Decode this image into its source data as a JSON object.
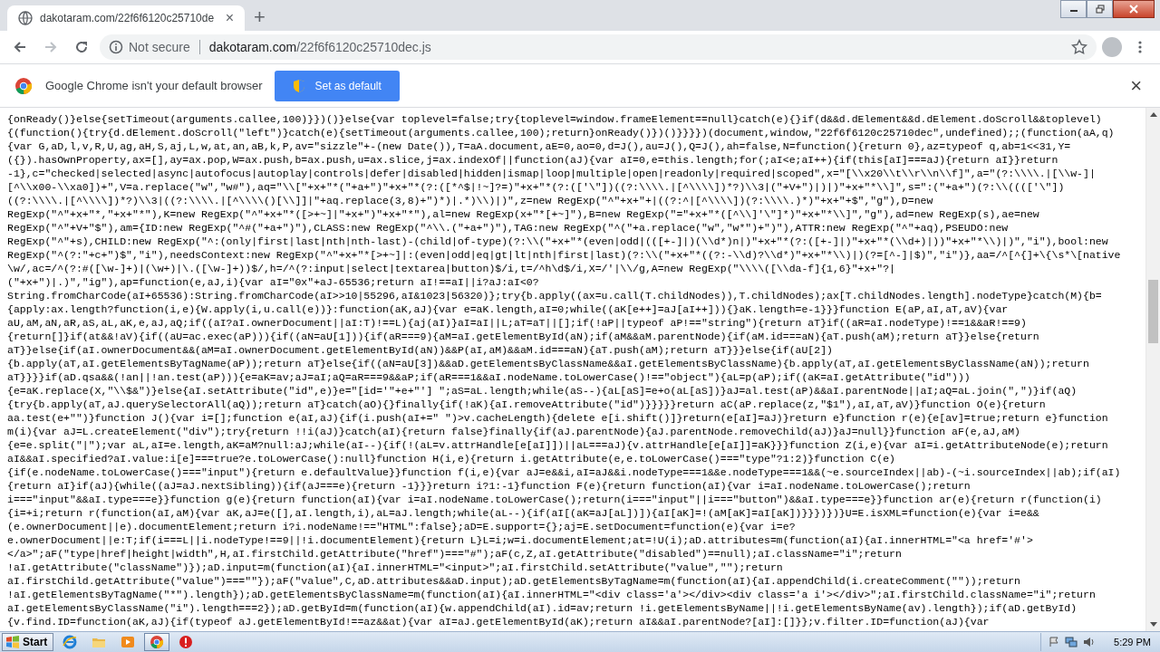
{
  "window": {
    "tab": {
      "title": "dakotaram.com/22f6f6120c25710de",
      "close": "×"
    },
    "new_tab": "+"
  },
  "toolbar": {
    "security": "Not secure",
    "url_host": "dakotaram.com",
    "url_path": "/22f6f6120c25710dec.js"
  },
  "infobar": {
    "message": "Google Chrome isn't your default browser",
    "button": "Set as default",
    "close": "×"
  },
  "code_lines": [
    "{onReady()}else{setTimeout(arguments.callee,100)}})()}else{var toplevel=false;try{toplevel=window.frameElement==null}catch(e){}if(d&&d.dElement&&d.dElement.doScroll&&toplevel)",
    "{(function(){try{d.dElement.doScroll(\"left\")}catch(e){setTimeout(arguments.callee,100);return}onReady()})()}}}})(document,window,\"22f6f6120c25710dec\",undefined);;(function(aA,q)",
    "{var G,aD,l,v,R,U,ag,aH,S,aj,L,w,at,an,aB,k,P,av=\"sizzle\"+-(new Date()),T=aA.document,aE=0,ao=0,d=J(),au=J(),Q=J(),ah=false,N=function(){return 0},az=typeof q,ab=1<<31,Y=",
    "({}).hasOwnProperty,ax=[],ay=ax.pop,W=ax.push,b=ax.push,u=ax.slice,j=ax.indexOf||function(aJ){var aI=0,e=this.length;for(;aI<e;aI++){if(this[aI]===aJ){return aI}}return",
    "-1},c=\"checked|selected|async|autofocus|autoplay|controls|defer|disabled|hidden|ismap|loop|multiple|open|readonly|required|scoped\",x=\"[\\\\x20\\\\t\\\\r\\\\n\\\\f]\",a=\"(?:\\\\\\\\.|[\\\\w-]|",
    "[^\\\\x00-\\\\xa0])+\",V=a.replace(\"w\",\"w#\"),aq=\"\\\\[\"+x+\"*(\"+a+\")\"+x+\"*(?:([*^$|!~]?=)\"+x+\"*(?:(['\\\"])((?:\\\\\\\\.|[^\\\\\\\\])*?)\\\\3|(\"+V+\")|)|)\"+x+\"*\\\\]\",s=\":(\"+a+\")(?:\\\\(((['\\\"])",
    "((?:\\\\\\\\.|[^\\\\\\\\])*?)\\\\3|((?:\\\\\\\\.|[^\\\\\\\\()[\\\\]]|\"+aq.replace(3,8)+\")*)|.*)\\\\)|)\",z=new RegExp(\"^\"+x+\"+|((?:^|[^\\\\\\\\])(?:\\\\\\\\.)*)\"+x+\"+$\",\"g\"),D=new",
    "RegExp(\"^\"+x+\"*,\"+x+\"*\"),K=new RegExp(\"^\"+x+\"*([>+~]|\"+x+\")\"+x+\"*\"),al=new RegExp(x+\"*[+~]\"),B=new RegExp(\"=\"+x+\"*([^\\\\]'\\\"]*)\"+x+\"*\\\\]\",\"g\"),ad=new RegExp(s),ae=new",
    "RegExp(\"^\"+V+\"$\"),am={ID:new RegExp(\"^#(\"+a+\")\"),CLASS:new RegExp(\"^\\\\.(\"+a+\")\"),TAG:new RegExp(\"^(\"+a.replace(\"w\",\"w*\")+\")\"),ATTR:new RegExp(\"^\"+aq),PSEUDO:new",
    "RegExp(\"^\"+s),CHILD:new RegExp(\"^:(only|first|last|nth|nth-last)-(child|of-type)(?:\\\\(\"+x+\"*(even|odd|(([+-]|)(\\\\d*)n|)\"+x+\"*(?:([+-]|)\"+x+\"*(\\\\d+)|))\"+x+\"*\\\\)|)\",\"i\"),bool:new",
    "RegExp(\"^(?:\"+c+\")$\",\"i\"),needsContext:new RegExp(\"^\"+x+\"*[>+~]|:(even|odd|eq|gt|lt|nth|first|last)(?:\\\\(\"+x+\"*((?:-\\\\d)?\\\\d*)\"+x+\"*\\\\)|)(?=[^-]|$)\",\"i\")},aa=/^[^{]+\\{\\s*\\[native",
    "\\w/,ac=/^(?:#([\\w-]+)|(\\w+)|\\.([\\w-]+))$/,h=/^(?:input|select|textarea|button)$/i,t=/^h\\d$/i,X=/'|\\\\/g,A=new RegExp(\"\\\\\\\\([\\\\da-f]{1,6}\"+x+\"?|",
    "(\"+x+\")|.)\",\"ig\"),ap=function(e,aJ,i){var aI=\"0x\"+aJ-65536;return aI!==aI||i?aJ:aI<0?",
    "String.fromCharCode(aI+65536):String.fromCharCode(aI>>10|55296,aI&1023|56320)};try{b.apply((ax=u.call(T.childNodes)),T.childNodes);ax[T.childNodes.length].nodeType}catch(M){b=",
    "{apply:ax.length?function(i,e){W.apply(i,u.call(e))}:function(aK,aJ){var e=aK.length,aI=0;while((aK[e++]=aJ[aI++])){}aK.length=e-1}}}function E(aP,aI,aT,aV){var",
    "aU,aM,aN,aR,aS,aL,aK,e,aJ,aQ;if((aI?aI.ownerDocument||aI:T)!==L){aj(aI)}aI=aI||L;aT=aT||[];if(!aP||typeof aP!==\"string\"){return aT}if((aR=aI.nodeType)!==1&&aR!==9)",
    "{return[]}if(at&&!aV){if((aU=ac.exec(aP))){if((aN=aU[1])){if(aR===9){aM=aI.getElementById(aN);if(aM&&aM.parentNode){if(aM.id===aN){aT.push(aM);return aT}}else{return",
    "aT}}else{if(aI.ownerDocument&&(aM=aI.ownerDocument.getElementById(aN))&&P(aI,aM)&&aM.id===aN){aT.push(aM);return aT}}}else{if(aU[2])",
    "{b.apply(aT,aI.getElementsByTagName(aP));return aT}else{if((aN=aU[3])&&aD.getElementsByClassName&&aI.getElementsByClassName){b.apply(aT,aI.getElementsByClassName(aN));return",
    "aT}}}}if(aD.qsa&&(!an||!an.test(aP))){e=aK=av;aJ=aI;aQ=aR===9&&aP;if(aR===1&&aI.nodeName.toLowerCase()!==\"object\"){aL=p(aP);if((aK=aI.getAttribute(\"id\")))",
    "{e=aK.replace(X,\"\\\\$&\")}else{aI.setAttribute(\"id\",e)}e=\"[id='\"+e+\"'] \";aS=aL.length;while(aS--){aL[aS]=e+o(aL[aS])}aJ=al.test(aP)&&aI.parentNode||aI;aQ=aL.join(\",\")}if(aQ)",
    "{try{b.apply(aT,aJ.querySelectorAll(aQ));return aT}catch(aO){}finally{if(!aK){aI.removeAttribute(\"id\")}}}}}return aC(aP.replace(z,\"$1\"),aI,aT,aV)}function O(e){return",
    "aa.test(e+\"\")}function J(){var i=[];function e(aI,aJ){if(i.push(aI+=\" \")>v.cacheLength){delete e[i.shift()]}return(e[aI]=aJ)}return e}function r(e){e[av]=true;return e}function",
    "m(i){var aJ=L.createElement(\"div\");try{return !!i(aJ)}catch(aI){return false}finally{if(aJ.parentNode){aJ.parentNode.removeChild(aJ)}aJ=null}}function aF(e,aJ,aM)",
    "{e=e.split(\"|\");var aL,aI=e.length,aK=aM?null:aJ;while(aI--){if(!(aL=v.attrHandle[e[aI]])||aL===aJ){v.attrHandle[e[aI]]=aK}}}function Z(i,e){var aI=i.getAttributeNode(e);return",
    "aI&&aI.specified?aI.value:i[e]===true?e.toLowerCase():null}function H(i,e){return i.getAttribute(e,e.toLowerCase()===\"type\"?1:2)}function C(e)",
    "{if(e.nodeName.toLowerCase()===\"input\"){return e.defaultValue}}function f(i,e){var aJ=e&&i,aI=aJ&&i.nodeType===1&&e.nodeType===1&&(~e.sourceIndex||ab)-(~i.sourceIndex||ab);if(aI)",
    "{return aI}if(aJ){while((aJ=aJ.nextSibling)){if(aJ===e){return -1}}}return i?1:-1}function F(e){return function(aI){var i=aI.nodeName.toLowerCase();return",
    "i===\"input\"&&aI.type===e}}function g(e){return function(aI){var i=aI.nodeName.toLowerCase();return(i===\"input\"||i===\"button\")&&aI.type===e}}function ar(e){return r(function(i)",
    "{i=+i;return r(function(aI,aM){var aK,aJ=e([],aI.length,i),aL=aJ.length;while(aL--){if(aI[(aK=aJ[aL])]){aI[aK]=!(aM[aK]=aI[aK])}}})})}U=E.isXML=function(e){var i=e&&",
    "(e.ownerDocument||e).documentElement;return i?i.nodeName!==\"HTML\":false};aD=E.support={};aj=E.setDocument=function(e){var i=e?",
    "e.ownerDocument||e:T;if(i===L||i.nodeType!==9||!i.documentElement){return L}L=i;w=i.documentElement;at=!U(i);aD.attributes=m(function(aI){aI.innerHTML=\"<a href='#'>",
    "</a>\";aF(\"type|href|height|width\",H,aI.firstChild.getAttribute(\"href\")===\"#\");aF(c,Z,aI.getAttribute(\"disabled\")==null);aI.className=\"i\";return",
    "!aI.getAttribute(\"className\")});aD.input=m(function(aI){aI.innerHTML=\"<input>\";aI.firstChild.setAttribute(\"value\",\"\");return",
    "aI.firstChild.getAttribute(\"value\")===\"\"});aF(\"value\",C,aD.attributes&&aD.input);aD.getElementsByTagName=m(function(aI){aI.appendChild(i.createComment(\"\"));return",
    "!aI.getElementsByTagName(\"*\").length});aD.getElementsByClassName=m(function(aI){aI.innerHTML=\"<div class='a'></div><div class='a i'></div>\";aI.firstChild.className=\"i\";return",
    "aI.getElementsByClassName(\"i\").length===2});aD.getById=m(function(aI){w.appendChild(aI).id=av;return !i.getElementsByName||!i.getElementsByName(av).length});if(aD.getById)",
    "{v.find.ID=function(aK,aJ){if(typeof aJ.getElementById!==az&&at){var aI=aJ.getElementById(aK);return aI&&aI.parentNode?[aI]:[]}};v.filter.ID=function(aJ){var"
  ],
  "taskbar": {
    "start": "Start",
    "apps": [
      {
        "kind": "ie",
        "selected": false
      },
      {
        "kind": "folder",
        "selected": false
      },
      {
        "kind": "media",
        "selected": false
      },
      {
        "kind": "chrome",
        "selected": true
      },
      {
        "kind": "stop",
        "selected": false
      }
    ],
    "clock": "5:29 PM"
  }
}
